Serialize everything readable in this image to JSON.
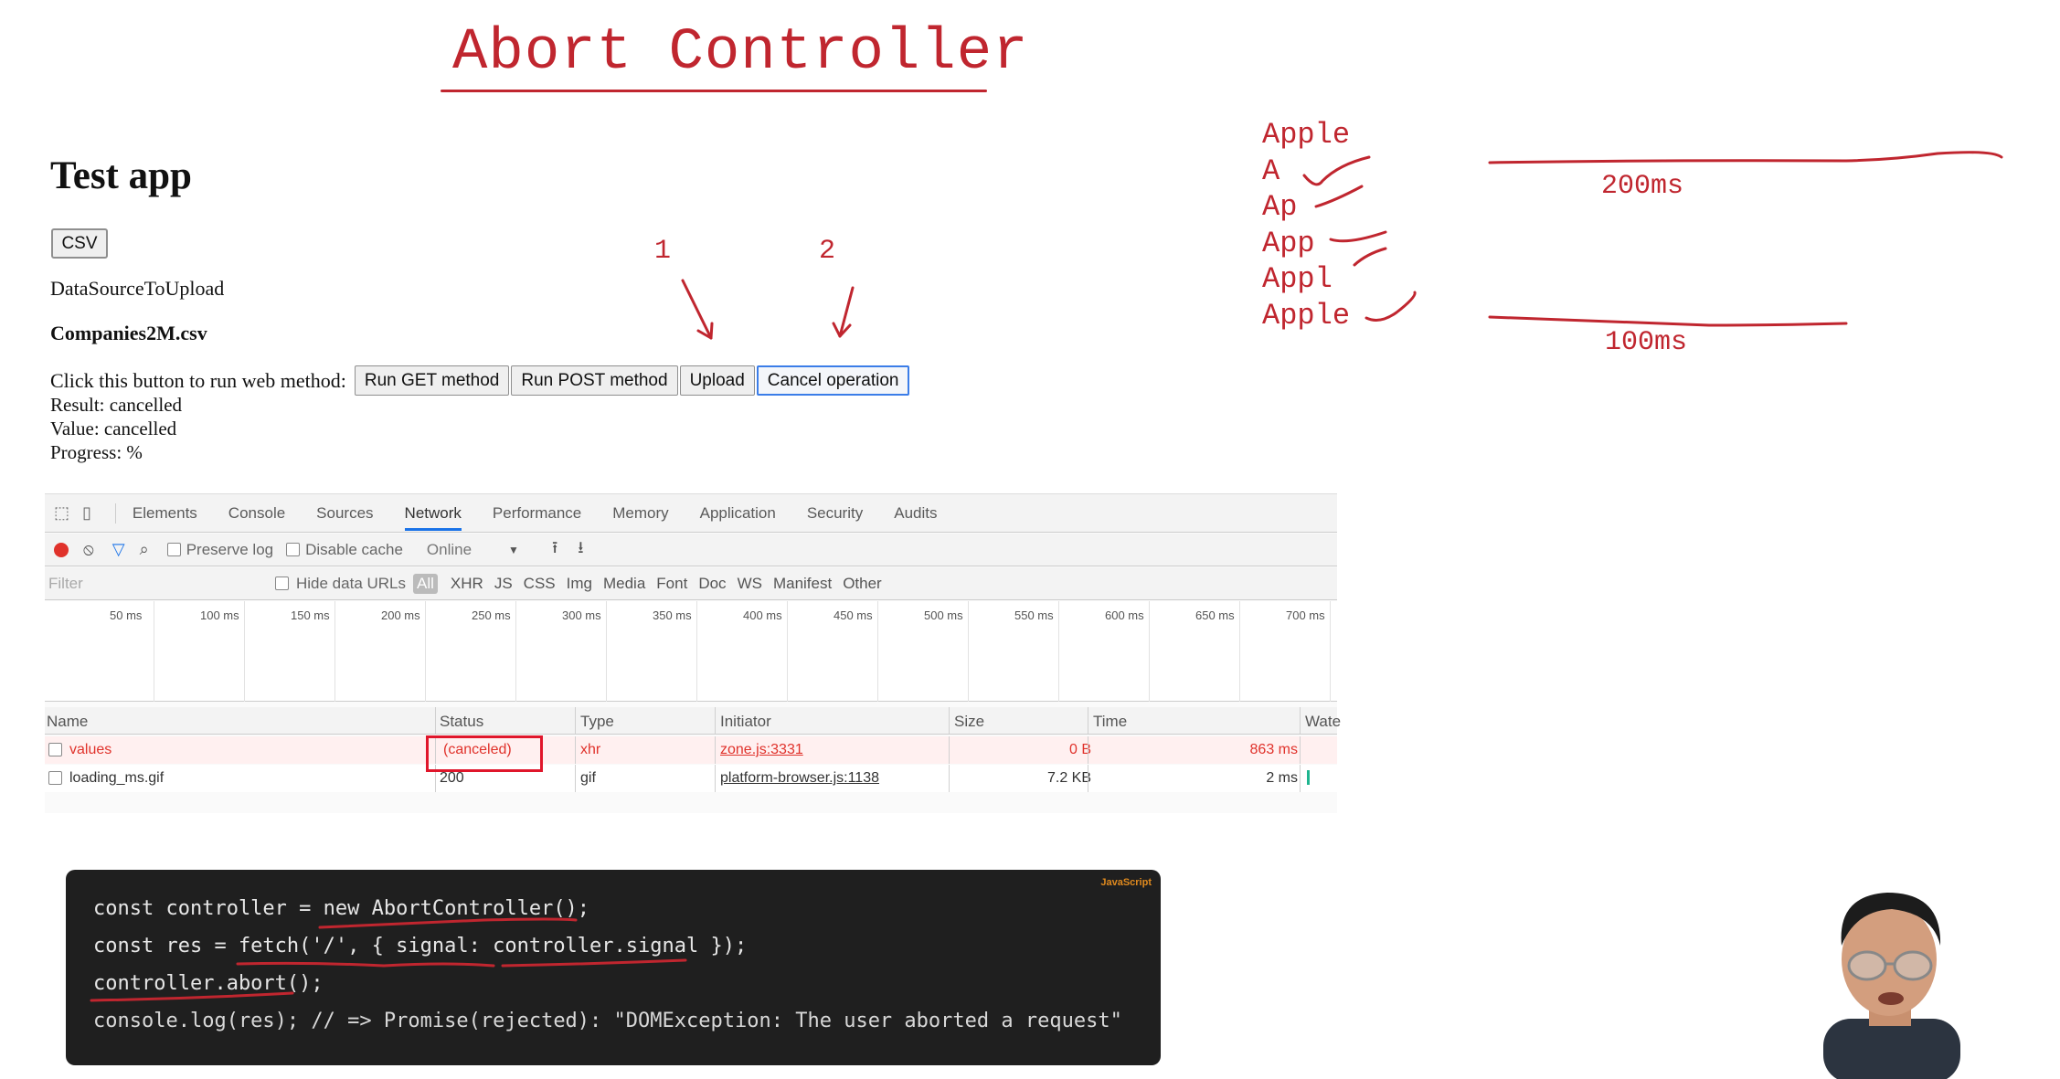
{
  "slide": {
    "title": "Abort Controller"
  },
  "app": {
    "heading": "Test app",
    "csv_button": "CSV",
    "datasource_label": "DataSourceToUpload",
    "file_name": "Companies2M.csv",
    "run_label": "Click this button to run web method:",
    "buttons": [
      "Run GET method",
      "Run POST method",
      "Upload",
      "Cancel operation"
    ],
    "result": "Result: cancelled",
    "value": "Value: cancelled",
    "progress": "Progress: %"
  },
  "annotations": {
    "marker_1": "1",
    "marker_2": "2",
    "words": [
      "Apple",
      "A",
      "Ap",
      "App",
      "Appl",
      "Apple"
    ],
    "time_1": "200ms",
    "time_2": "100ms"
  },
  "devtools": {
    "tabs": [
      "Elements",
      "Console",
      "Sources",
      "Network",
      "Performance",
      "Memory",
      "Application",
      "Security",
      "Audits"
    ],
    "active_tab": "Network",
    "preserve_log": "Preserve log",
    "disable_cache": "Disable cache",
    "throttle": "Online",
    "filter_placeholder": "Filter",
    "hide_data_urls": "Hide data URLs",
    "filter_types": [
      "All",
      "XHR",
      "JS",
      "CSS",
      "Img",
      "Media",
      "Font",
      "Doc",
      "WS",
      "Manifest",
      "Other"
    ],
    "timeline_ticks": [
      "50 ms",
      "100 ms",
      "150 ms",
      "200 ms",
      "250 ms",
      "300 ms",
      "350 ms",
      "400 ms",
      "450 ms",
      "500 ms",
      "550 ms",
      "600 ms",
      "650 ms",
      "700 ms"
    ],
    "columns": [
      "Name",
      "Status",
      "Type",
      "Initiator",
      "Size",
      "Time",
      "Wate"
    ],
    "rows": [
      {
        "name": "values",
        "status": "(canceled)",
        "type": "xhr",
        "initiator": "zone.js:3331",
        "size": "0 B",
        "time": "863 ms"
      },
      {
        "name": "loading_ms.gif",
        "status": "200",
        "type": "gif",
        "initiator": "platform-browser.js:1138",
        "size": "7.2 KB",
        "time": "2 ms"
      }
    ],
    "colors": {
      "error": "#e0322b",
      "accent": "#1a73e8"
    }
  },
  "code": {
    "badge": "JavaScript",
    "lines": [
      "const controller = new AbortController();",
      "const res = fetch('/', { signal: controller.signal });",
      "controller.abort();",
      "console.log(res); // => Promise(rejected): \"DOMException: The user aborted a request\""
    ]
  }
}
